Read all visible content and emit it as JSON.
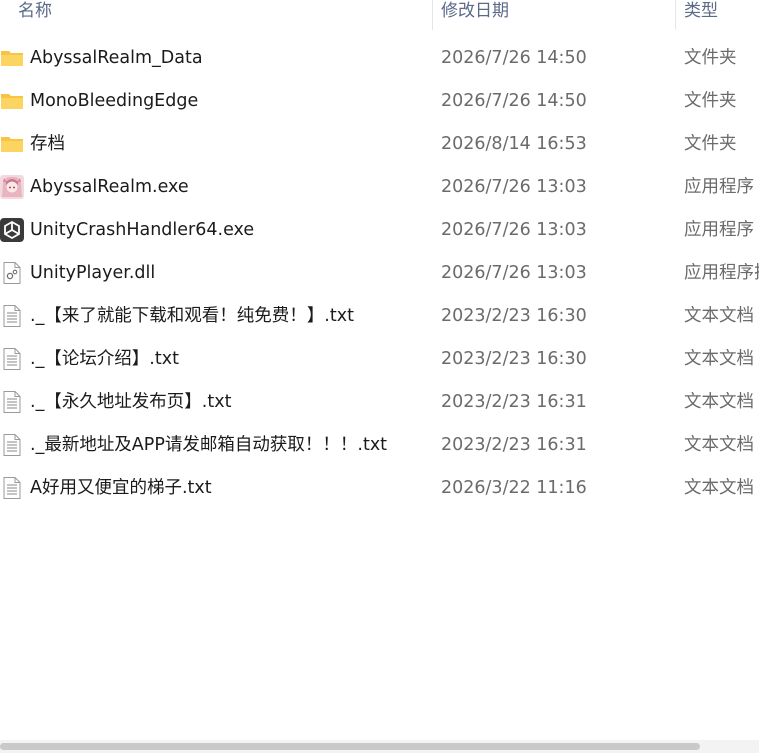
{
  "columns": {
    "name": "名称",
    "date": "修改日期",
    "type": "类型"
  },
  "files": [
    {
      "name": "AbyssalRealm_Data",
      "date": "2026/7/26 14:50",
      "type": "文件夹",
      "icon": "folder-icon"
    },
    {
      "name": "MonoBleedingEdge",
      "date": "2026/7/26 14:50",
      "type": "文件夹",
      "icon": "folder-icon"
    },
    {
      "name": "存档",
      "date": "2026/8/14 16:53",
      "type": "文件夹",
      "icon": "folder-icon"
    },
    {
      "name": "AbyssalRealm.exe",
      "date": "2026/7/26 13:03",
      "type": "应用程序",
      "icon": "app-avatar-icon"
    },
    {
      "name": "UnityCrashHandler64.exe",
      "date": "2026/7/26 13:03",
      "type": "应用程序",
      "icon": "unity-icon"
    },
    {
      "name": "UnityPlayer.dll",
      "date": "2026/7/26 13:03",
      "type": "应用程序扩",
      "icon": "dll-file-icon"
    },
    {
      "name": "._【来了就能下载和观看！纯免费！】.txt",
      "date": "2023/2/23 16:30",
      "type": "文本文档",
      "icon": "text-file-icon"
    },
    {
      "name": "._【论坛介绍】.txt",
      "date": "2023/2/23 16:30",
      "type": "文本文档",
      "icon": "text-file-icon"
    },
    {
      "name": "._【永久地址发布页】.txt",
      "date": "2023/2/23 16:31",
      "type": "文本文档",
      "icon": "text-file-icon"
    },
    {
      "name": "._最新地址及APP请发邮箱自动获取！！！.txt",
      "date": "2023/2/23 16:31",
      "type": "文本文档",
      "icon": "text-file-icon"
    },
    {
      "name": "A好用又便宜的梯子.txt",
      "date": "2026/3/22 11:16",
      "type": "文本文档",
      "icon": "text-file-icon"
    }
  ],
  "colors": {
    "folder": "#F8C542",
    "header_text": "#5A6A87",
    "meta_text": "#6B6B6B"
  }
}
